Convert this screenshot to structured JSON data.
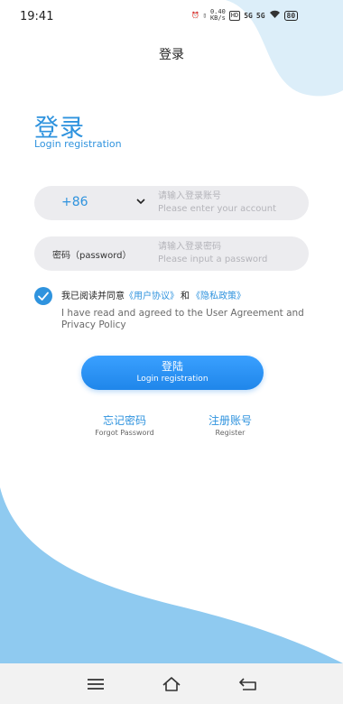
{
  "status_bar": {
    "time": "19:41",
    "speed_value": "0.40",
    "speed_unit": "KB/s",
    "hd_badge": "HD",
    "net1": "5G",
    "net2": "5G",
    "battery": "80"
  },
  "header": {
    "title": "登录"
  },
  "hero": {
    "title": "登录",
    "subtitle": "Login registration"
  },
  "account_field": {
    "country_code": "+86",
    "placeholder_cn": "请输入登录账号",
    "placeholder_en": "Please enter your account"
  },
  "password_field": {
    "label": "密码（password）",
    "placeholder_cn": "请输入登录密码",
    "placeholder_en": "Please input a password"
  },
  "agreement": {
    "checked": true,
    "prefix": "我已阅读并同意",
    "user_agreement": "《用户协议》",
    "conjunction": "和",
    "privacy_policy": "《隐私政策》",
    "english": "I have read and agreed to the User Agreement and Privacy Policy"
  },
  "login_button": {
    "label_cn": "登陆",
    "label_en": "Login registration"
  },
  "links": {
    "forgot_cn": "忘记密码",
    "forgot_en": "Forgot Password",
    "register_cn": "注册账号",
    "register_en": "Register"
  },
  "colors": {
    "accent": "#2f93de",
    "background_wave": "#8fcaf0",
    "field_bg": "#ececef"
  },
  "icons": [
    "wifi-icon",
    "chevron-down-icon",
    "check-icon",
    "menu-icon",
    "home-icon",
    "back-icon"
  ]
}
